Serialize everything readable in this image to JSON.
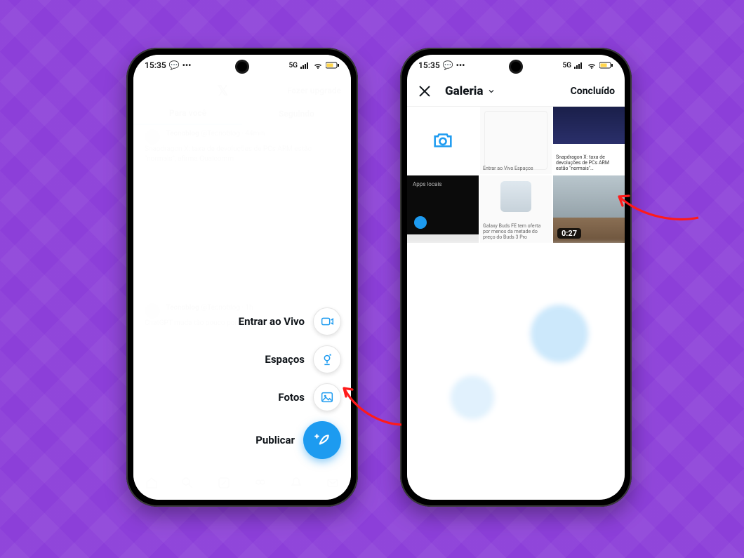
{
  "background_color": "#8c3fd9",
  "status_bar": {
    "time": "15:35",
    "network_label": "5G",
    "battery_color": "#ffd54a"
  },
  "left_phone": {
    "header": {
      "upgrade_label": "Fazer upgrade",
      "logo": "𝕏"
    },
    "tabs": {
      "for_you": "Para você",
      "following": "Seguindo"
    },
    "feed": {
      "author": "Tecnoblog",
      "handle": "@Tecnoblog · 44min",
      "headline": "Snapdragon X: taxa de devoluções de PCs ARM estão \"normais\", afirma Qualcomm",
      "post2_author": "Tecnoblog",
      "post2_handle": "@Tecnoblog · 1h",
      "post2_headline": "ChatGPT muda tão pouco por..."
    },
    "fab_menu": [
      {
        "label": "Entrar ao Vivo",
        "icon": "live-icon"
      },
      {
        "label": "Espaços",
        "icon": "spaces-icon"
      },
      {
        "label": "Fotos",
        "icon": "photos-icon"
      },
      {
        "label": "Publicar",
        "icon": "compose-icon",
        "primary": true
      }
    ],
    "bottom_nav_icons": [
      "home",
      "search",
      "grok",
      "communities",
      "notifications",
      "messages"
    ]
  },
  "right_phone": {
    "header": {
      "title": "Galeria",
      "done": "Concluído"
    },
    "camera_tile_label": "camera",
    "video_duration": "0:27",
    "thumbnails": [
      {
        "kind": "camera"
      },
      {
        "kind": "screenshot",
        "caption": "Entrar ao Vivo  Espaços"
      },
      {
        "kind": "article",
        "caption": "Snapdragon X: taxa de devoluções de PCs ARM estão \"normais\"…"
      },
      {
        "kind": "dark_app",
        "caption": "Apps locais"
      },
      {
        "kind": "product",
        "caption": "Galaxy Buds FE tem oferta por menos da metade do preço do Buds 3 Pro"
      },
      {
        "kind": "video_sky",
        "duration": "0:27"
      }
    ]
  },
  "colors": {
    "twitter_blue": "#1d9bf0",
    "arrow_red": "#ff1a1a"
  }
}
